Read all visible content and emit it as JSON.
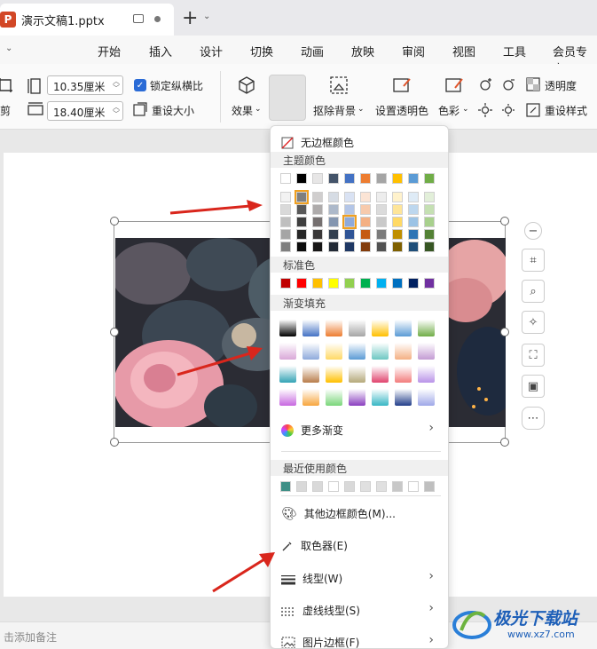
{
  "window": {
    "doc_title": "演示文稿1.pptx",
    "app_badge": "P",
    "new_tab": "+"
  },
  "menu": {
    "items": [
      "开始",
      "插入",
      "设计",
      "切换",
      "动画",
      "放映",
      "审阅",
      "视图",
      "工具",
      "会员专享"
    ]
  },
  "ribbon": {
    "crop_label": "剪",
    "width_value": "10.35厘米",
    "height_value": "18.40厘米",
    "lock_ratio": "锁定纵横比",
    "reset_size": "重设大小",
    "effect": "效果",
    "border": "边框",
    "remove_bg": "抠除背景",
    "set_transparent": "设置透明色",
    "color": "色彩",
    "transparency": "透明度",
    "reset_style": "重设样式"
  },
  "panel": {
    "no_border": "无边框颜色",
    "theme_colors_header": "主题颜色",
    "theme_top": [
      "#ffffff",
      "#000000",
      "#e7e6e6",
      "#44546a",
      "#4472c4",
      "#ed7d31",
      "#a5a5a5",
      "#ffc000",
      "#5b9bd5",
      "#70ad47"
    ],
    "theme_shades": [
      [
        "#f2f2f2",
        "#7f7f7f",
        "#d0cece",
        "#d6dce4",
        "#d9e2f3",
        "#fbe4d5",
        "#ededed",
        "#fff2cc",
        "#deebf6",
        "#e2efd9"
      ],
      [
        "#d9d9d9",
        "#595959",
        "#aeabab",
        "#adb9ca",
        "#b4c6e7",
        "#f7caac",
        "#dbdbdb",
        "#fee599",
        "#bdd7ee",
        "#c5e0b3"
      ],
      [
        "#bfbfbf",
        "#3f3f3f",
        "#757070",
        "#8496b0",
        "#8eaadb",
        "#f4b083",
        "#c9c9c9",
        "#ffd965",
        "#9cc3e5",
        "#a8d08d"
      ],
      [
        "#a5a5a5",
        "#262626",
        "#3a3838",
        "#323f4f",
        "#2f5496",
        "#c55a11",
        "#7b7b7b",
        "#bf8f00",
        "#2e75b5",
        "#538135"
      ],
      [
        "#7f7f7f",
        "#0c0c0c",
        "#171616",
        "#222a35",
        "#1f3864",
        "#833c0b",
        "#525252",
        "#7f6000",
        "#1e4e79",
        "#375623"
      ]
    ],
    "standard_header": "标准色",
    "standard_colors": [
      "#c00000",
      "#ff0000",
      "#ffc000",
      "#ffff00",
      "#92d050",
      "#00b050",
      "#00b0f0",
      "#0070c0",
      "#002060",
      "#7030a0"
    ],
    "gradient_header": "渐变填充",
    "gradients": [
      [
        "#000000",
        "#4472c4",
        "#ed7d31",
        "#a5a5a5",
        "#ffc000",
        "#5b9bd5",
        "#70ad47"
      ],
      [
        "#d9a8d8",
        "#8eaadb",
        "#ffd965",
        "#5b9bd5",
        "#6cc7c2",
        "#f4b083",
        "#c39bd3"
      ],
      [
        "#33a3b5",
        "#b87d4b",
        "#ffc000",
        "#b5a97a",
        "#e0446e",
        "#f27c7c",
        "#b993e8"
      ],
      [
        "#c768e0",
        "#f7a63e",
        "#7ad67a",
        "#8a3fbf",
        "#37b6c4",
        "#223e8a",
        "#9fa8e8"
      ]
    ],
    "more_gradients": "更多渐变",
    "recent_header": "最近使用颜色",
    "recent_colors": [
      "#3f8f86",
      "#d9d9d9",
      "#d9d9d9",
      "#ffffff",
      "#d9d9d9",
      "#e0e0e0",
      "#e0e0e0",
      "#c8c8c8",
      "#ffffff",
      "#bfbfbf"
    ],
    "other_colors": "其他边框颜色(M)...",
    "eyedropper": "取色器(E)",
    "line_type": "线型(W)",
    "dash_type": "虚线线型(S)",
    "picture_border": "图片边框(F)"
  },
  "notes": {
    "placeholder": "击添加备注"
  },
  "watermark": {
    "title": "极光下载站",
    "url": "www.xz7.com"
  },
  "colors": {
    "accent": "#2a6bd6",
    "arrow": "#d9261c"
  }
}
